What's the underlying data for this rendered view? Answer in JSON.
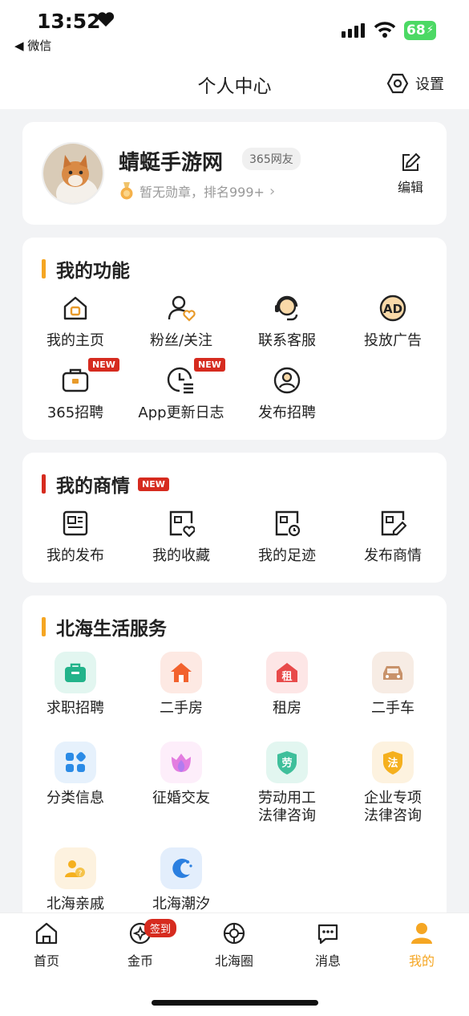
{
  "status": {
    "time": "13:52",
    "back_app": "◀ 微信",
    "battery": "68"
  },
  "nav": {
    "title": "个人中心",
    "settings": "设置"
  },
  "profile": {
    "name": "蜻蜓手游网",
    "badge": "365网友",
    "medal_text": "暂无勋章，排名999+",
    "edit": "编辑"
  },
  "functions": {
    "title": "我的功能",
    "items": [
      {
        "label": "我的主页",
        "icon": "home-icon"
      },
      {
        "label": "粉丝/关注",
        "icon": "user-heart-icon"
      },
      {
        "label": "联系客服",
        "icon": "headset-icon"
      },
      {
        "label": "投放广告",
        "icon": "ad-icon"
      },
      {
        "label": "365招聘",
        "icon": "briefcase-icon",
        "tag": "NEW"
      },
      {
        "label": "App更新日志",
        "icon": "clock-list-icon",
        "tag": "NEW"
      },
      {
        "label": "发布招聘",
        "icon": "user-circle-icon"
      }
    ]
  },
  "business": {
    "title": "我的商情",
    "tag": "NEW",
    "items": [
      {
        "label": "我的发布",
        "icon": "document-icon"
      },
      {
        "label": "我的收藏",
        "icon": "favorite-doc-icon"
      },
      {
        "label": "我的足迹",
        "icon": "history-doc-icon"
      },
      {
        "label": "发布商情",
        "icon": "edit-doc-icon"
      }
    ]
  },
  "services": {
    "title": "北海生活服务",
    "items": [
      {
        "label": "求职招聘",
        "icon": "job-icon"
      },
      {
        "label": "二手房",
        "icon": "house-icon"
      },
      {
        "label": "租房",
        "icon": "rent-icon",
        "glyph": "租"
      },
      {
        "label": "二手车",
        "icon": "car-icon"
      },
      {
        "label": "分类信息",
        "icon": "category-icon"
      },
      {
        "label": "征婚交友",
        "icon": "flower-icon"
      },
      {
        "label": "劳动用工\n法律咨询",
        "label1": "劳动用工",
        "label2": "法律咨询",
        "icon": "labor-law-icon",
        "glyph": "劳"
      },
      {
        "label": "企业专项\n法律咨询",
        "label1": "企业专项",
        "label2": "法律咨询",
        "icon": "enterprise-law-icon",
        "glyph": "法"
      },
      {
        "label": "北海亲戚",
        "icon": "relatives-icon"
      },
      {
        "label": "北海潮汐",
        "icon": "tide-icon"
      }
    ]
  },
  "tabs": [
    {
      "label": "首页",
      "icon": "home-tab-icon"
    },
    {
      "label": "金币",
      "icon": "coin-icon",
      "badge": "签到"
    },
    {
      "label": "北海圈",
      "icon": "aperture-icon"
    },
    {
      "label": "消息",
      "icon": "message-icon"
    },
    {
      "label": "我的",
      "icon": "profile-tab-icon",
      "active": true
    }
  ],
  "colors": {
    "accent": "#f5a623",
    "new_red": "#d62b1f",
    "active_tab": "#f5a623"
  }
}
